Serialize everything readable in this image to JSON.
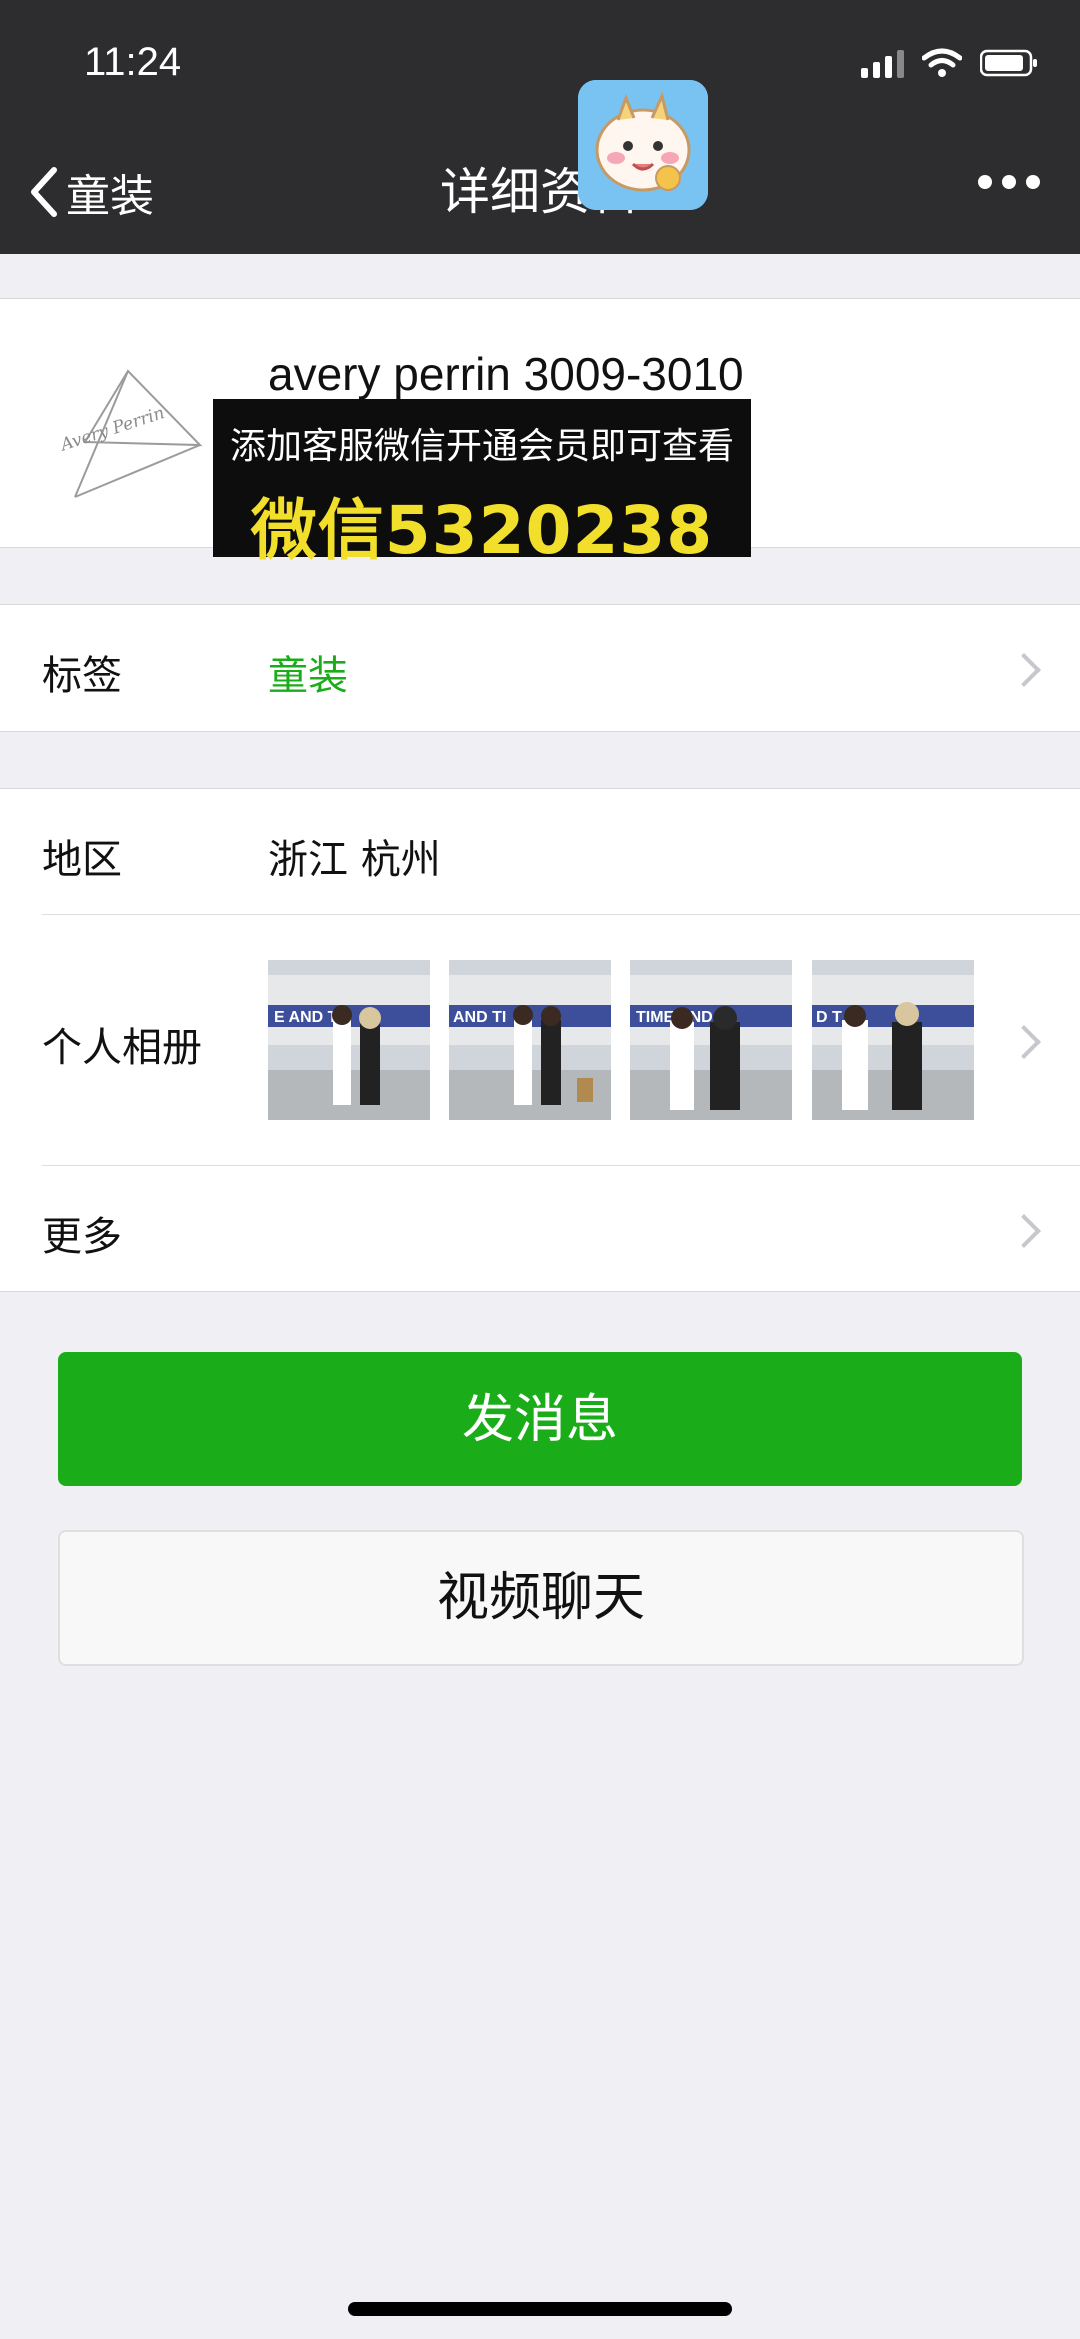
{
  "status_bar": {
    "time": "11:24"
  },
  "nav": {
    "back_label": "童装",
    "title": "详细资料"
  },
  "profile": {
    "name": "avery perrin 3009-3010",
    "logo_text": "Avery Perrin"
  },
  "promo_overlay": {
    "line1": "添加客服微信开通会员即可查看",
    "line2": "微信5320238"
  },
  "tags": {
    "label": "标签",
    "value": "童装"
  },
  "region": {
    "label": "地区",
    "value": "浙江 杭州"
  },
  "album": {
    "label": "个人相册",
    "photo_count": 4
  },
  "more": {
    "label": "更多"
  },
  "actions": {
    "send_message": "发消息",
    "video_call": "视频聊天"
  },
  "colors": {
    "accent_green": "#1aad19",
    "tag_green": "#1aad19",
    "header_bg": "#2d2d2f",
    "page_bg": "#efeff4",
    "promo_yellow": "#f1df2b"
  }
}
